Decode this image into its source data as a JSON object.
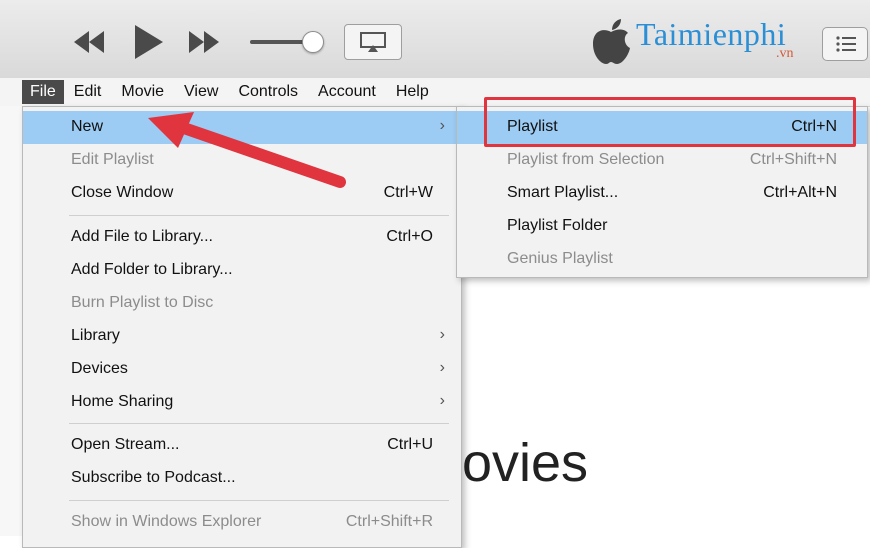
{
  "toolbar": {
    "icons": [
      "rewind-icon",
      "play-icon",
      "fast-forward-icon",
      "volume-slider",
      "airplay-icon",
      "apple-logo",
      "list-view-icon"
    ],
    "brand": "Taimienphi",
    "brand_sub": ".vn"
  },
  "menubar": {
    "items": [
      {
        "label": "File",
        "active": true
      },
      {
        "label": "Edit"
      },
      {
        "label": "Movie"
      },
      {
        "label": "View"
      },
      {
        "label": "Controls"
      },
      {
        "label": "Account"
      },
      {
        "label": "Help"
      }
    ]
  },
  "file_menu": {
    "items": [
      {
        "label": "New",
        "shortcut": "",
        "submenu": true,
        "highlighted": true,
        "disabled": false
      },
      {
        "label": "Edit Playlist",
        "shortcut": "",
        "disabled": true
      },
      {
        "label": "Close Window",
        "shortcut": "Ctrl+W",
        "disabled": false
      },
      {
        "label": "Add File to Library...",
        "shortcut": "Ctrl+O",
        "disabled": false
      },
      {
        "label": "Add Folder to Library...",
        "shortcut": "",
        "disabled": false
      },
      {
        "label": "Burn Playlist to Disc",
        "shortcut": "",
        "disabled": true
      },
      {
        "label": "Library",
        "shortcut": "",
        "submenu": true,
        "disabled": false
      },
      {
        "label": "Devices",
        "shortcut": "",
        "submenu": true,
        "disabled": false
      },
      {
        "label": "Home Sharing",
        "shortcut": "",
        "submenu": true,
        "disabled": false
      },
      {
        "label": "Open Stream...",
        "shortcut": "Ctrl+U",
        "disabled": false
      },
      {
        "label": "Subscribe to Podcast...",
        "shortcut": "",
        "disabled": false
      },
      {
        "label": "Show in Windows Explorer",
        "shortcut": "Ctrl+Shift+R",
        "disabled": true
      }
    ],
    "submenu_arrow": "›"
  },
  "new_submenu": {
    "items": [
      {
        "label": "Playlist",
        "shortcut": "Ctrl+N",
        "highlighted": true,
        "disabled": false
      },
      {
        "label": "Playlist from Selection",
        "shortcut": "Ctrl+Shift+N",
        "disabled": true
      },
      {
        "label": "Smart Playlist...",
        "shortcut": "Ctrl+Alt+N",
        "disabled": false
      },
      {
        "label": "Playlist Folder",
        "shortcut": "",
        "disabled": false
      },
      {
        "label": "Genius Playlist",
        "shortcut": "",
        "disabled": true
      }
    ]
  },
  "background": {
    "partial_heading": "ovies"
  },
  "colors": {
    "highlight": "#9ccbf3",
    "annotation_red": "#e0343f",
    "brand_blue": "#2b8fd6"
  }
}
